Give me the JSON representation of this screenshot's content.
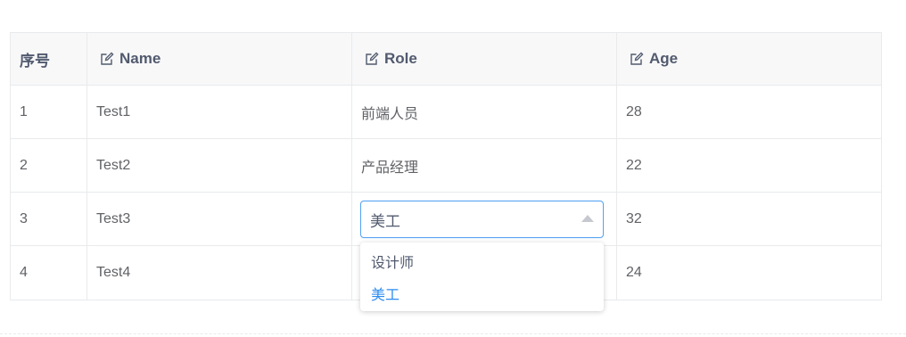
{
  "table": {
    "columns": [
      {
        "label": "序号",
        "editable": false
      },
      {
        "label": "Name",
        "editable": true,
        "icon": "edit-icon"
      },
      {
        "label": "Role",
        "editable": true,
        "icon": "edit-icon"
      },
      {
        "label": "Age",
        "editable": true,
        "icon": "edit-icon"
      }
    ],
    "rows": [
      {
        "index": "1",
        "name": "Test1",
        "role": "前端人员",
        "age": "28"
      },
      {
        "index": "2",
        "name": "Test2",
        "role": "产品经理",
        "age": "22"
      },
      {
        "index": "3",
        "name": "Test3",
        "role": "美工",
        "age": "32"
      },
      {
        "index": "4",
        "name": "Test4",
        "role": "",
        "age": "24"
      }
    ]
  },
  "role_select": {
    "value": "美工",
    "open": true,
    "options": [
      {
        "label": "设计师",
        "selected": false
      },
      {
        "label": "美工",
        "selected": true
      }
    ],
    "accent_color": "#2d8cf0"
  }
}
